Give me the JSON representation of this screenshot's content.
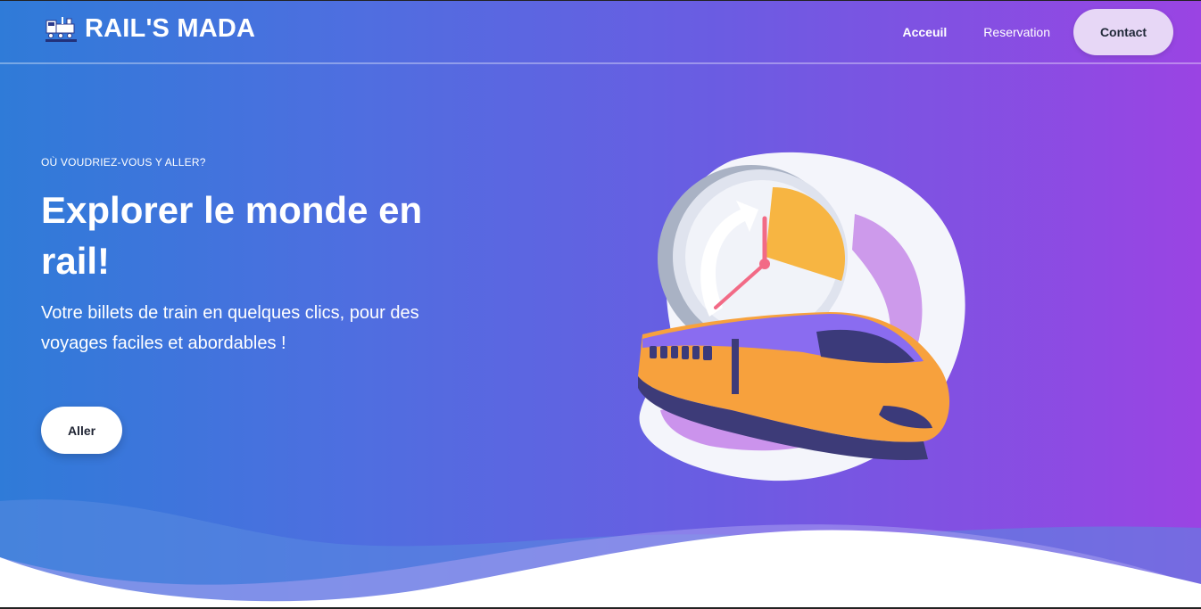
{
  "brand": {
    "name": "RAIL'S MADA",
    "icon": "train-logo-icon"
  },
  "nav": {
    "links": [
      {
        "label": "Acceuil",
        "active": true
      },
      {
        "label": "Reservation",
        "active": false
      }
    ],
    "contact_label": "Contact"
  },
  "hero": {
    "eyebrow": "OÙ VOUDRIEZ-VOUS Y ALLER?",
    "headline": "Explorer le monde en rail!",
    "subtitle": "Votre billets de train en quelques clics, pour des voyages faciles et abordables !",
    "cta_label": "Aller"
  },
  "illustration": {
    "icon": "train-clock-illustration"
  },
  "colors": {
    "gradient_start": "#2f7bd8",
    "gradient_end": "#9a44e3",
    "contact_bg": "#e7d7f6",
    "train_orange": "#f7a13d",
    "train_purple": "#8a6cf0"
  }
}
